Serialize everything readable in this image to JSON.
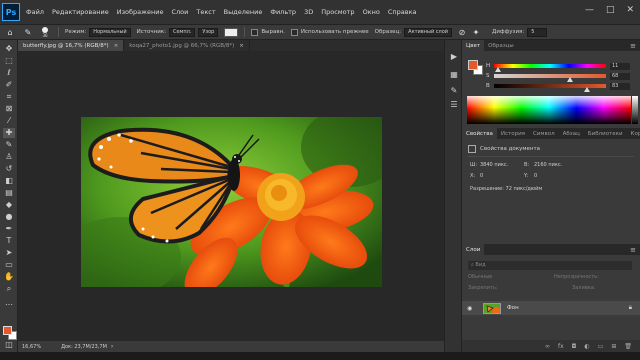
{
  "app": {
    "logo": "Ps"
  },
  "menu": [
    "Файл",
    "Редактирование",
    "Изображение",
    "Слои",
    "Текст",
    "Выделение",
    "Фильтр",
    "3D",
    "Просмотр",
    "Окно",
    "Справка"
  ],
  "window_controls": {
    "minimize": "—",
    "maximize": "□",
    "close": "✕"
  },
  "options": {
    "size": "36",
    "mode_label": "Режим:",
    "mode_value": "Нормальный",
    "source_label": "Источник:",
    "sampled": "Семпл.",
    "pattern": "Узор",
    "aligned": "Выравн.",
    "use_legacy": "Использовать прежнее",
    "sample_label": "Образец:",
    "sample_value": "Активный слой",
    "diffusion_label": "Диффузия:",
    "diffusion_value": "5"
  },
  "tabs": [
    {
      "label": "butterfly.jpg @ 16,7% (RGB/8*)",
      "close": "×",
      "active": true
    },
    {
      "label": "koqa27_photo1.jpg @ 66,7% (RGB/8*)",
      "close": "×",
      "active": false
    }
  ],
  "status": {
    "zoom": "16,67%",
    "doc": "Док: 23,7M/23,7M",
    "arrow": "›"
  },
  "color_panel": {
    "tabs": [
      "Цвет",
      "Образцы"
    ],
    "foreground": "#e5582c",
    "background": "#ffffff",
    "sliders": [
      {
        "label": "H",
        "value": "11",
        "pos": 0.03
      },
      {
        "label": "S",
        "value": "68",
        "pos": 0.68
      },
      {
        "label": "B",
        "value": "83",
        "pos": 0.83
      }
    ]
  },
  "properties_panel": {
    "tabs": [
      "Свойства",
      "История",
      "Символ",
      "Абзац",
      "Библиотеки",
      "Коррекция"
    ],
    "title": "Свойства документа",
    "width_label": "Ш:",
    "width_value": "3840 пикс.",
    "height_label": "В:",
    "height_value": "2160 пикс.",
    "x_label": "X:",
    "x_value": "0",
    "y_label": "Y:",
    "y_value": "0",
    "resolution": "Разрешение: 72 пикс/дюйм"
  },
  "layers_panel": {
    "tabs": [
      "Слои"
    ],
    "search": "Вид",
    "blend": "Обычные",
    "opacity_label": "Непрозрачность:",
    "lock_label": "Закрепить:",
    "fill_label": "Заливка:",
    "layer_name": "Фон",
    "footer_icons": [
      "link-icon",
      "fx-icon",
      "mask-icon",
      "adjust-icon",
      "folder-icon",
      "new-layer-icon",
      "trash-icon"
    ]
  }
}
